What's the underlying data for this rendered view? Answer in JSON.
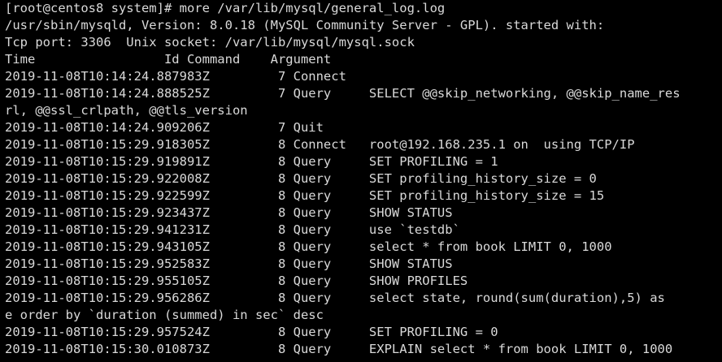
{
  "terminal": {
    "prompt_line": "[root@centos8 system]# more /var/lib/mysql/general_log.log",
    "header_lines": [
      "/usr/sbin/mysqld, Version: 8.0.18 (MySQL Community Server - GPL). started with:",
      "Tcp port: 3306  Unix socket: /var/lib/mysql/mysql.sock",
      "Time                 Id Command    Argument"
    ],
    "log_lines": [
      "2019-11-08T10:14:24.887983Z         7 Connect",
      "2019-11-08T10:14:24.888525Z         7 Query     SELECT @@skip_networking, @@skip_name_res",
      "rl, @@ssl_crlpath, @@tls_version",
      "2019-11-08T10:14:24.909206Z         7 Quit",
      "2019-11-08T10:15:29.918305Z         8 Connect   root@192.168.235.1 on  using TCP/IP",
      "2019-11-08T10:15:29.919891Z         8 Query     SET PROFILING = 1",
      "2019-11-08T10:15:29.922008Z         8 Query     SET profiling_history_size = 0",
      "2019-11-08T10:15:29.922599Z         8 Query     SET profiling_history_size = 15",
      "2019-11-08T10:15:29.923437Z         8 Query     SHOW STATUS",
      "2019-11-08T10:15:29.941231Z         8 Query     use `testdb`",
      "2019-11-08T10:15:29.943105Z         8 Query     select * from book LIMIT 0, 1000",
      "2019-11-08T10:15:29.952583Z         8 Query     SHOW STATUS",
      "2019-11-08T10:15:29.955105Z         8 Query     SHOW PROFILES",
      "2019-11-08T10:15:29.956286Z         8 Query     select state, round(sum(duration),5) as",
      "e order by `duration (summed) in sec` desc",
      "2019-11-08T10:15:29.957524Z         8 Query     SET PROFILING = 0",
      "2019-11-08T10:15:30.010873Z         8 Query     EXPLAIN select * from book LIMIT 0, 1000"
    ],
    "colors": {
      "background": "#000000",
      "foreground": "#d9d9d9"
    }
  }
}
